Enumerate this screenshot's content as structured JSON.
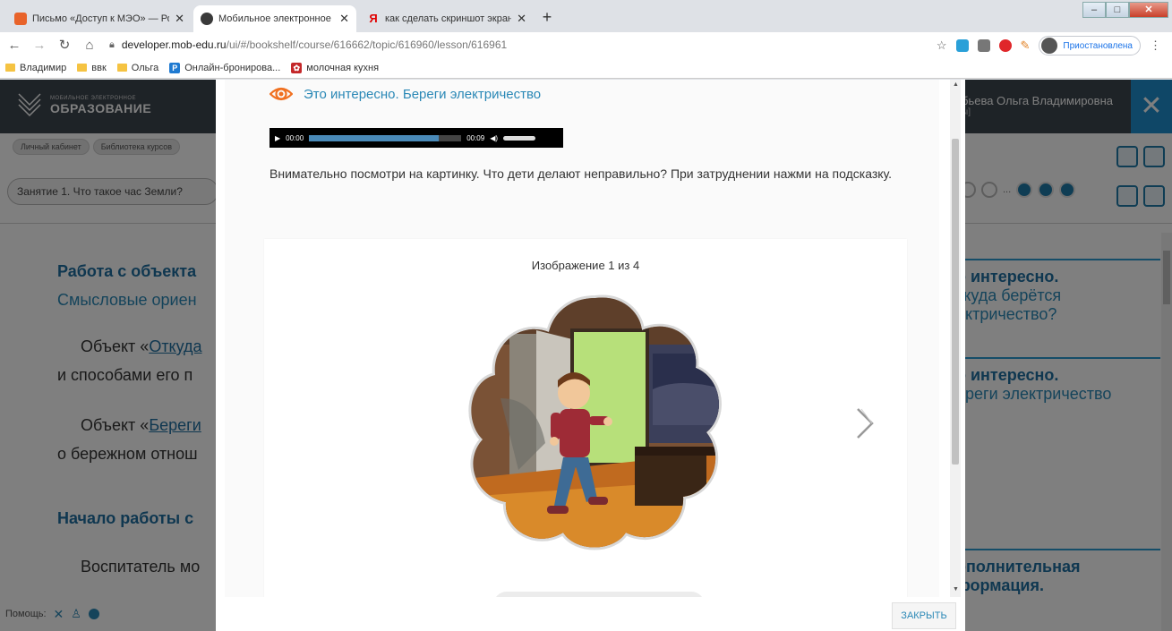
{
  "browser": {
    "tabs": [
      {
        "title": "Письмо «Доступ к МЭО» — Род",
        "favicon_color": "#e8632a",
        "active": false
      },
      {
        "title": "Мобильное электронное обра",
        "favicon_color": "#3a3a3a",
        "active": true
      },
      {
        "title": "как сделать скриншот экрана н",
        "favicon_color": "#e00000",
        "active": false
      }
    ],
    "new_tab": "+",
    "url_host": "developer.mob-edu.ru",
    "url_path": "/ui/#/bookshelf/course/616662/topic/616960/lesson/616961",
    "profile_status": "Приостановлена",
    "bookmarks": [
      {
        "label": "Владимир",
        "type": "folder"
      },
      {
        "label": "ввк",
        "type": "folder"
      },
      {
        "label": "Ольга",
        "type": "folder"
      },
      {
        "label": "Онлайн-бронирова...",
        "type": "page",
        "badge": "P",
        "color": "#1f7ad1"
      },
      {
        "label": "молочная кухня",
        "type": "page",
        "badge": "✿",
        "color": "#c4282a"
      }
    ]
  },
  "site": {
    "logo_line1": "МОБИЛЬНОЕ ЭЛЕКТРОННОЕ",
    "logo_line2": "ОБРАЗОВАНИЕ",
    "user_name": "бьева Ольга Владимировна",
    "user_sub": "ы]",
    "crumbs": [
      "Личный кабинет",
      "Библиотека курсов"
    ],
    "lesson_select": "Занятие 1. Что такое час Земли?",
    "pager_ellipsis": "...",
    "background": {
      "heading1": "Работа с объекта",
      "subheading1": "Смысловые ориен",
      "para1_prefix": "Объект «",
      "para1_link": "Откуда",
      "para1_line2": "и способами его п",
      "para2_prefix": "Объект «",
      "para2_link": "Береги",
      "para2_line2": "о бережном отнош",
      "heading2": "Начало работы с",
      "para3": "Воспитатель мо"
    },
    "right_cards": [
      {
        "title": "о интересно.",
        "sub1": "ткуда берётся",
        "sub2": "ектричество?"
      },
      {
        "title": "о интересно.",
        "sub1": "ереги электричество",
        "sub2": ""
      },
      {
        "title": "ополнительная",
        "sub1": "формация.",
        "sub2": ""
      }
    ],
    "footer_help": "Помощь:"
  },
  "modal": {
    "title": "Это интересно. Береги электричество",
    "audio": {
      "current": "00:00",
      "duration": "00:09",
      "progress": 0.85
    },
    "instruction": "Внимательно посмотри на картинку. Что дети делают неправильно? При затруднении нажми на подсказку.",
    "image_counter": "Изображение 1 из 4",
    "close_button": "ЗАКРЫТЬ"
  },
  "colors": {
    "accent": "#2a88b6",
    "header_bg": "#3d464f",
    "close_blue": "#1f8fcf"
  }
}
